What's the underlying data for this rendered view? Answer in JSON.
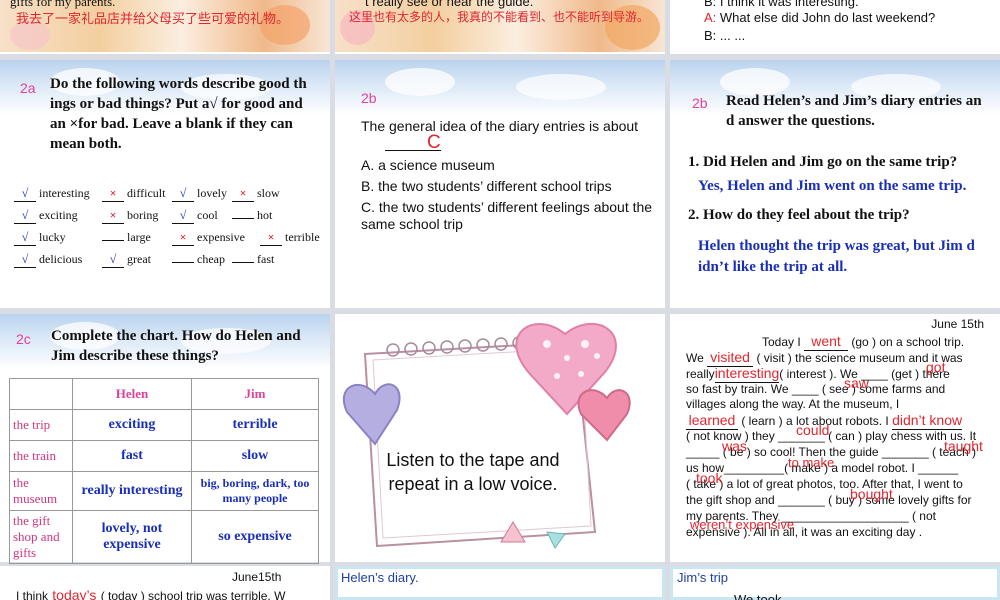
{
  "top": {
    "p1_line": "gifts for my parents.",
    "p1_chinese": "我去了一家礼品店并给父母买了些可爱的礼物。",
    "p2_line": "t really see or hear the guide.",
    "p2_chinese": "这里也有太多的人，我真的不能看到、也不能听到导游。",
    "p3_line1": "B: I think it was interesting.",
    "p3_line2_speaker": "A:",
    "p3_line2": " What else did John do last weekend?",
    "p3_line3": "B: ... ..."
  },
  "p2a": {
    "tag": "2a",
    "instruction": "Do the following words describe good things or bad things? Put a√ for good and an ×for bad. Leave a blank if they can mean both.",
    "rows": [
      [
        {
          "mark": "√",
          "word": "interesting"
        },
        {
          "mark": "×",
          "word": "difficult"
        },
        {
          "mark": "√",
          "word": "lovely"
        },
        {
          "mark": "×",
          "word": "slow"
        }
      ],
      [
        {
          "mark": "√",
          "word": "exciting"
        },
        {
          "mark": "×",
          "word": "boring"
        },
        {
          "mark": "√",
          "word": "cool"
        },
        {
          "mark": "",
          "word": "hot"
        }
      ],
      [
        {
          "mark": "√",
          "word": "lucky"
        },
        {
          "mark": "",
          "word": "large"
        },
        {
          "mark": "×",
          "word": "expensive"
        },
        {
          "mark": "×",
          "word": "terrible"
        }
      ],
      [
        {
          "mark": "√",
          "word": "delicious"
        },
        {
          "mark": "√",
          "word": "great"
        },
        {
          "mark": "",
          "word": "cheap"
        },
        {
          "mark": "",
          "word": "fast"
        }
      ]
    ]
  },
  "p2b_middle": {
    "tag": "2b",
    "question": "The general idea of the diary entries is about",
    "answer": "C",
    "options": [
      "A. a science museum",
      "B. the two students’ different school trips",
      "C. the two students’ different feelings about the same school trip"
    ]
  },
  "p2b_right": {
    "tag": "2b",
    "instruction": "Read Helen’s and Jim’s diary entries and answer the questions.",
    "q1": "1. Did Helen and Jim go on the same trip?",
    "a1": "Yes, Helen and Jim went on the same trip.",
    "q2": "2. How do they feel about the trip?",
    "a2": "Helen thought the trip was great, but Jim didn’t like the trip at all."
  },
  "p2c": {
    "tag": "2c",
    "instruction": "Complete the chart. How do Helen and Jim describe these things?",
    "headers": [
      "",
      "Helen",
      "Jim"
    ],
    "rows": [
      {
        "label": "the trip",
        "helen": "exciting",
        "jim": "terrible"
      },
      {
        "label": "the train",
        "helen": "fast",
        "jim": "slow"
      },
      {
        "label": "the museum",
        "helen": "really interesting",
        "jim": "big, boring, dark, too many people"
      },
      {
        "label": "the gift shop and gifts",
        "helen": "lovely, not expensive",
        "jim": "so expensive"
      }
    ]
  },
  "listen": {
    "text": "Listen to the tape and repeat in a low voice."
  },
  "diary": {
    "date": "June 15th",
    "l1a": "Today I ",
    "went": "went",
    "l1b": " (go ) on a school trip.",
    "l2a": "We ",
    "visited": "visited",
    "l2b": " ( visit ) the science museum and it was",
    "l3a": "really",
    "interesting": "interesting",
    "l3b": "( interest ). We ____ (get ) there",
    "got": "got",
    "l4": "so fast by train. We ____ ( see ) some farms and",
    "saw": "saw",
    "l5": "villages along the way. At the museum, I",
    "learned": "learned",
    "l6b": " ( learn ) a lot about robots. I ",
    "didnt_know": "didn’t know",
    "l7": "( not know ) they _______ ( can ) play chess with us. It",
    "could": "could",
    "l8": "_____ ( be ) so cool! Then the guide _______ ( teach )",
    "was": "was",
    "taught": "taught",
    "l9": "us how_________( make ) a model robot. I ______",
    "to_make": "to make",
    "l10": "( take ) a lot of great photos, too. After that, I went to",
    "took": "took",
    "l11": "the gift shop and _______ ( buy ) some lovely gifts for",
    "bought": "bought",
    "l12": "my parents. They ___________________ ( not",
    "l13": "expensive ). All in all,  it was an exciting day .",
    "werent_expensive": "weren’t expensive"
  },
  "bottom": {
    "date": "June15th",
    "line_a": "I think ",
    "todays": "today’s",
    "line_b": " ( today ) school trip was terrible. W",
    "helen_title": "Helen’s diary.",
    "jim_title": "Jim’s trip",
    "jim_partial": "We took"
  }
}
